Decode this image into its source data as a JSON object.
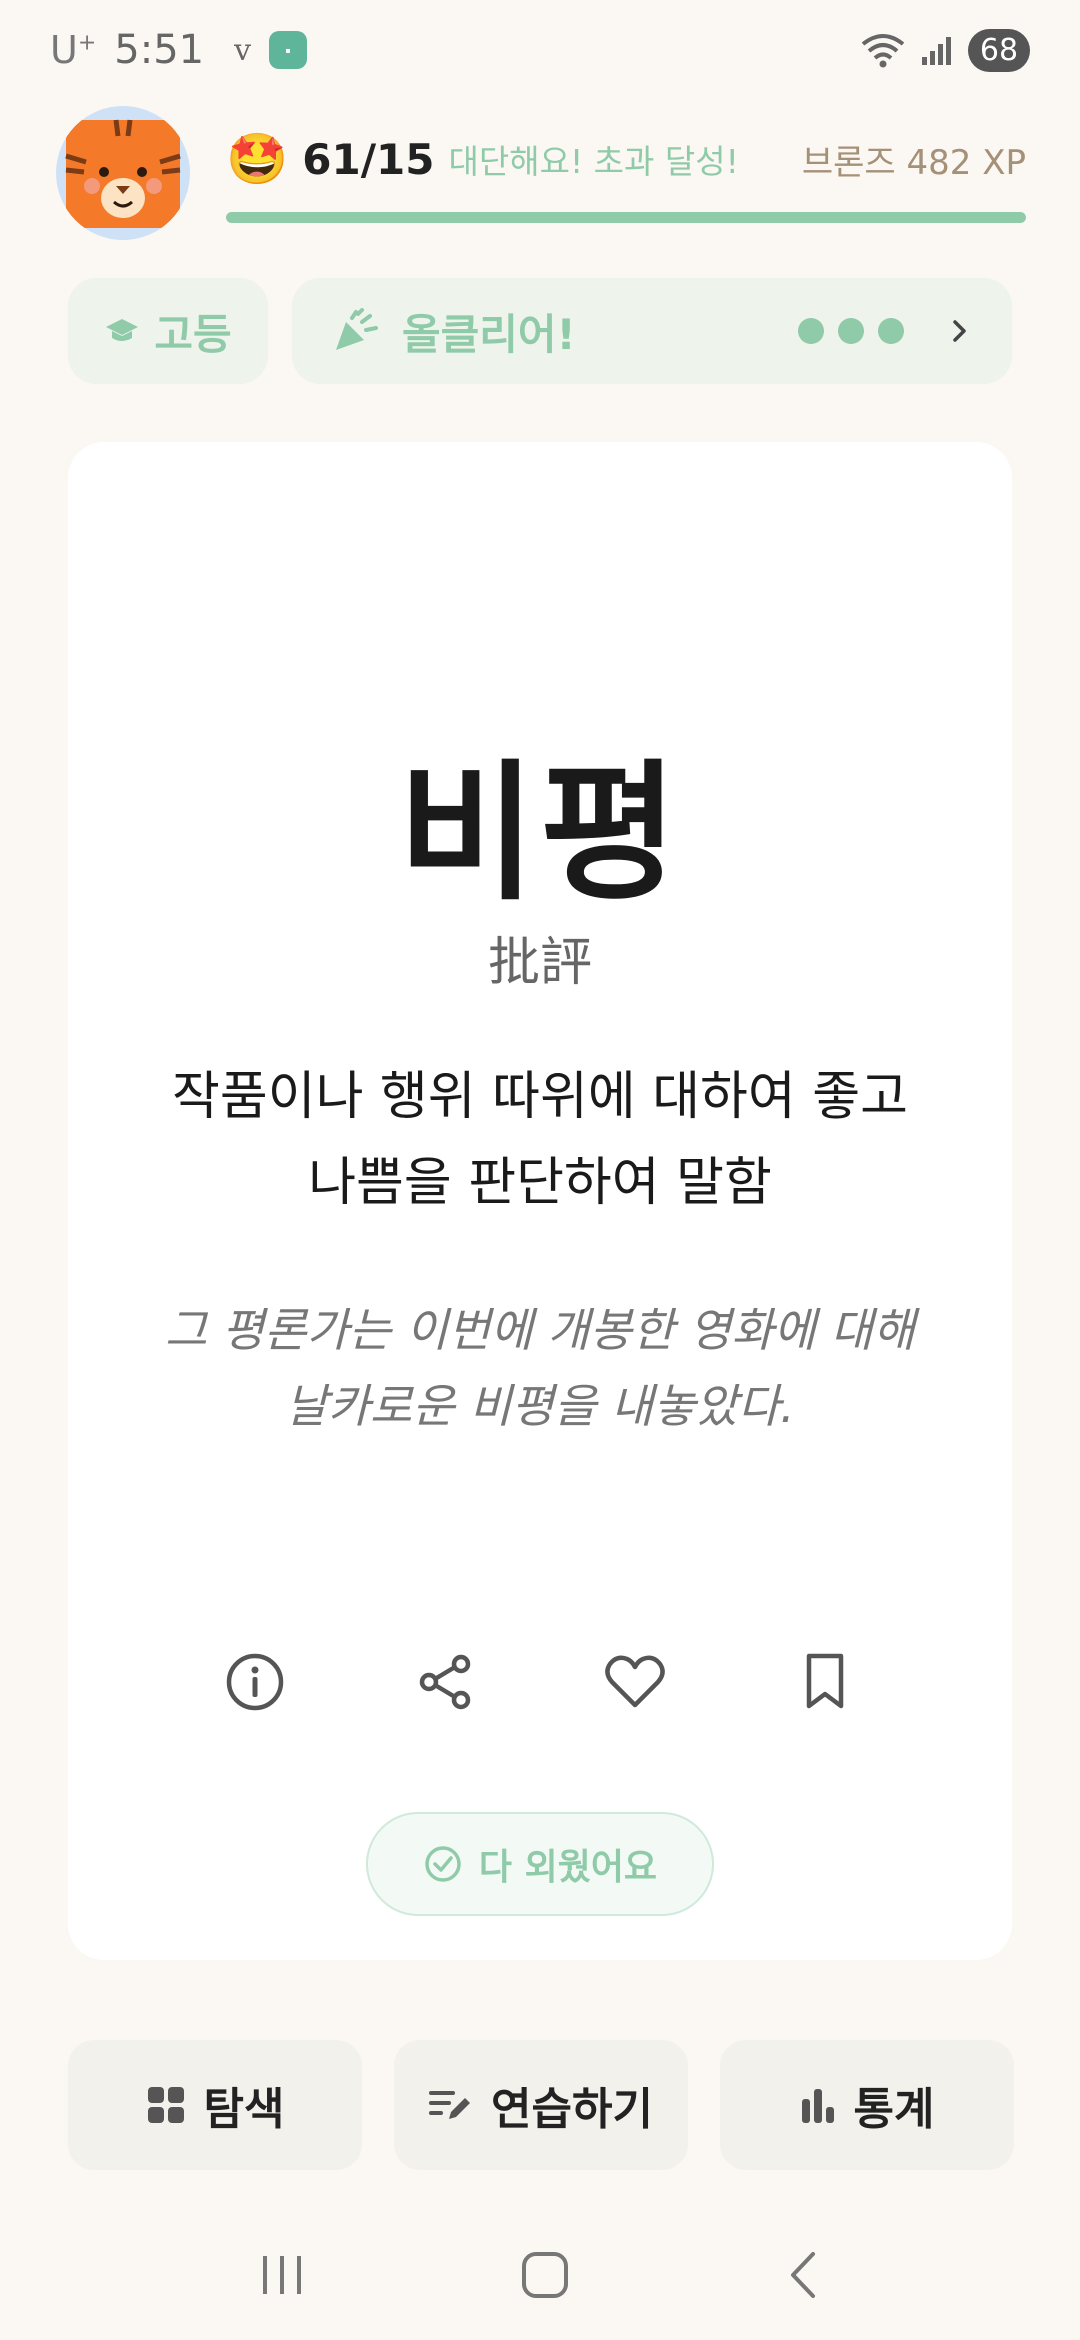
{
  "status_bar": {
    "carrier": "U",
    "carrier_sup": "+",
    "time": "5:51",
    "extra": "v",
    "battery": "68"
  },
  "header": {
    "emoji": "🤩",
    "progress_text": "61/15",
    "progress_fraction": 1.0,
    "achievement": "대단해요! 초과 달성!",
    "rank": "브론즈 482 XP"
  },
  "chips": {
    "level": "고등",
    "goal": "올클리어!"
  },
  "card": {
    "word": "비평",
    "hanja": "批評",
    "meaning": "작품이나 행위 따위에 대하여 좋고 나쁨을 판단하여 말함",
    "example": "그 평론가는 이번에 개봉한 영화에 대해 날카로운 비평을 내놓았다.",
    "memorized_label": "다 외웠어요"
  },
  "bottom_nav": {
    "explore": "탐색",
    "practice": "연습하기",
    "stats": "통계"
  },
  "colors": {
    "accent": "#8fcaa9",
    "background": "#fbf8f3",
    "rank": "#a59078"
  }
}
